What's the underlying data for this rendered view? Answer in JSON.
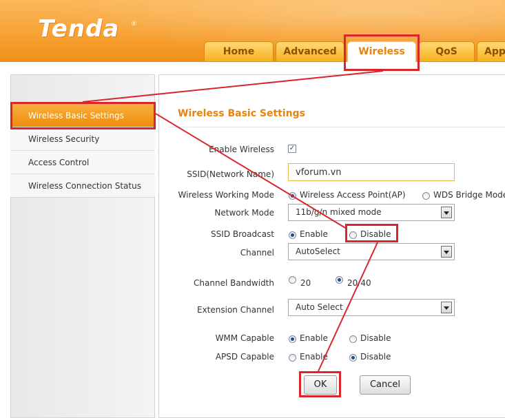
{
  "header": {
    "logo_text": "Tenda",
    "logo_mark": "®",
    "tabs": [
      "Home",
      "Advanced",
      "Wireless",
      "QoS",
      "App"
    ],
    "active_tab": "Wireless"
  },
  "sidebar": {
    "items": [
      "Wireless Basic Settings",
      "Wireless Security",
      "Access Control",
      "Wireless Connection Status"
    ],
    "active_item": "Wireless Basic Settings"
  },
  "main": {
    "title": "Wireless Basic Settings",
    "enable_wireless": {
      "label": "Enable Wireless",
      "checked": true
    },
    "ssid": {
      "label": "SSID(Network Name)",
      "value": "vforum.vn"
    },
    "working_mode": {
      "label": "Wireless Working Mode",
      "options": [
        "Wireless Access Point(AP)",
        "WDS Bridge Mode"
      ],
      "selected": "Wireless Access Point(AP)"
    },
    "network_mode": {
      "label": "Network Mode",
      "value": "11b/g/n mixed mode"
    },
    "ssid_broadcast": {
      "label": "SSID Broadcast",
      "options": [
        "Enable",
        "Disable"
      ],
      "selected": "Enable"
    },
    "channel": {
      "label": "Channel",
      "value": "AutoSelect"
    },
    "channel_bandwidth": {
      "label": "Channel Bandwidth",
      "options": [
        "20",
        "20/40"
      ],
      "selected": "20/40"
    },
    "extension_channel": {
      "label": "Extension Channel",
      "value": "Auto Select"
    },
    "wmm": {
      "label": "WMM Capable",
      "options": [
        "Enable",
        "Disable"
      ],
      "selected": "Enable"
    },
    "apsd": {
      "label": "APSD Capable",
      "options": [
        "Enable",
        "Disable"
      ],
      "selected": "Disable"
    },
    "ok_label": "OK",
    "cancel_label": "Cancel"
  },
  "colors": {
    "brand_orange": "#f7a234",
    "accent_title": "#e8820e",
    "annotation_red": "#d8262c"
  }
}
